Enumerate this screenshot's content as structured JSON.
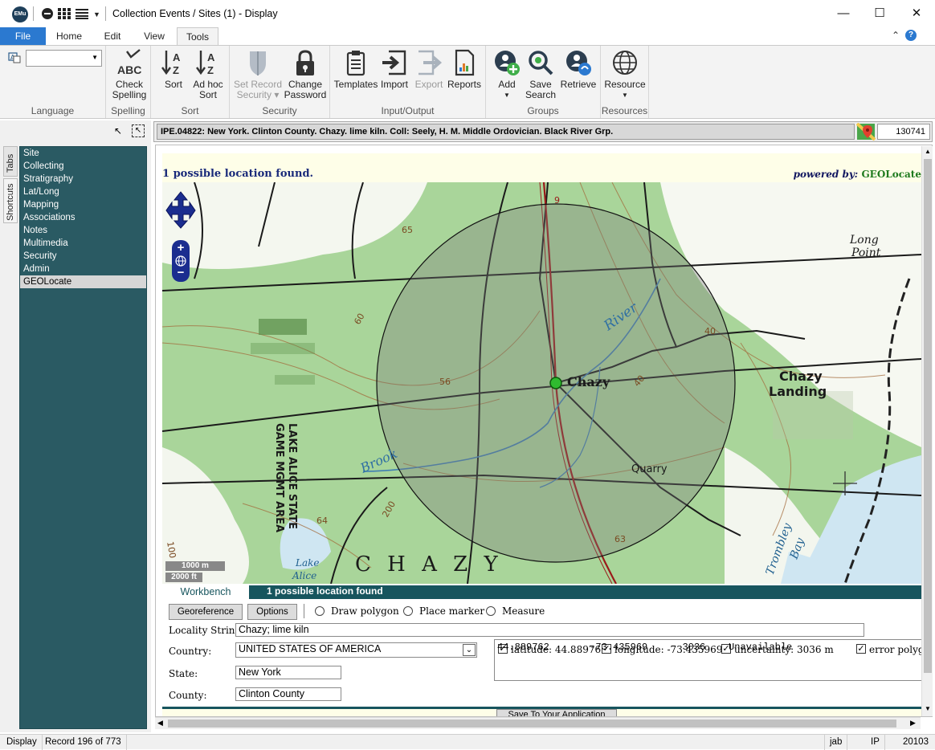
{
  "app": {
    "logo_text": "EMu",
    "window_title": "Collection Events / Sites (1) - Display"
  },
  "ribbon_tabs": [
    "File",
    "Home",
    "Edit",
    "View",
    "Tools"
  ],
  "ribbon": {
    "groups": {
      "language": "Language",
      "spelling": "Spelling",
      "sort": "Sort",
      "security": "Security",
      "input_output": "Input/Output",
      "groups": "Groups",
      "resources": "Resources"
    },
    "buttons": {
      "check_spelling": [
        "Check",
        "Spelling"
      ],
      "sort": [
        "Sort",
        ""
      ],
      "adhoc_sort": [
        "Ad hoc",
        "Sort"
      ],
      "set_record_security": [
        "Set Record",
        "Security"
      ],
      "change_password": [
        "Change",
        "Password"
      ],
      "templates": "Templates",
      "import": "Import",
      "export": "Export",
      "reports": "Reports",
      "add": "Add",
      "save_search": [
        "Save",
        "Search"
      ],
      "retrieve": "Retrieve",
      "resource": "Resource"
    },
    "abc_text": "ABC"
  },
  "side_tabs": [
    "Tabs",
    "Shortcuts"
  ],
  "nav_items": [
    "Site",
    "Collecting",
    "Stratigraphy",
    "Lat/Long",
    "Mapping",
    "Associations",
    "Notes",
    "Multimedia",
    "Security",
    "Admin",
    "GEOLocate"
  ],
  "record": {
    "summary": "IPE.04822: New York. Clinton County. Chazy. lime kiln. Coll: Seely, H. M. Middle Ordovician. Black River Grp.",
    "irn": "130741"
  },
  "geolocate": {
    "found_text": "1 possible location found.",
    "powered_prefix": "powered by:",
    "powered_brand": "GEOLocate",
    "map_labels": {
      "town": "Chazy",
      "landing_1": "Chazy",
      "landing_2": "Landing",
      "point_1": "Long",
      "point_2": "Point",
      "river": "River",
      "brook": "Brook",
      "quarry": "Quarry",
      "region": "C H A Z Y",
      "game_area_1": "LAKE ALICE STATE",
      "game_area_2": "GAME MGMT AREA",
      "lake_1": "Lake",
      "lake_2": "Alice",
      "bay_1": "Trombley",
      "bay_2": "Bay",
      "contour_65": "65",
      "contour_60": "60",
      "contour_56": "56",
      "contour_40a": "40",
      "contour_40b": "40",
      "contour_64": "64",
      "contour_63": "63",
      "contour_100": "100",
      "route_9": "9",
      "contour_200": "200"
    },
    "scale_m": "1000 m",
    "scale_ft": "2000 ft",
    "tab_workbench": "Workbench",
    "tab_result": "1 possible location found",
    "btn_georeference": "Georeference",
    "btn_options": "Options",
    "radio_draw_polygon": "Draw polygon",
    "radio_place_marker": "Place marker",
    "radio_measure": "Measure",
    "locality_label": "Locality String:",
    "locality_value": "Chazy; lime kiln",
    "country_label": "Country:",
    "country_value": "UNITED STATES OF AMERICA",
    "state_label": "State:",
    "state_value": "New York",
    "county_label": "County:",
    "county_value": "Clinton County",
    "chk_latitude": "latitude: 44.889762",
    "chk_longitude": "longitude: -73.435969",
    "chk_uncertainty": "uncertainty: 3036 m",
    "chk_error_polygon": "error polygon",
    "results_line": "44.889762       -73.435969      3036    Unavailable",
    "save_button": "Save To Your Application"
  },
  "status": {
    "mode": "Display",
    "record_pos": "Record 196 of 773",
    "user": "jab",
    "ip": "IP",
    "port": "20103"
  },
  "colors": {
    "accent": "#2b79d0",
    "nav_bg": "#2a5a63",
    "teal_tab": "#17555e",
    "map_green": "#a8d399"
  }
}
